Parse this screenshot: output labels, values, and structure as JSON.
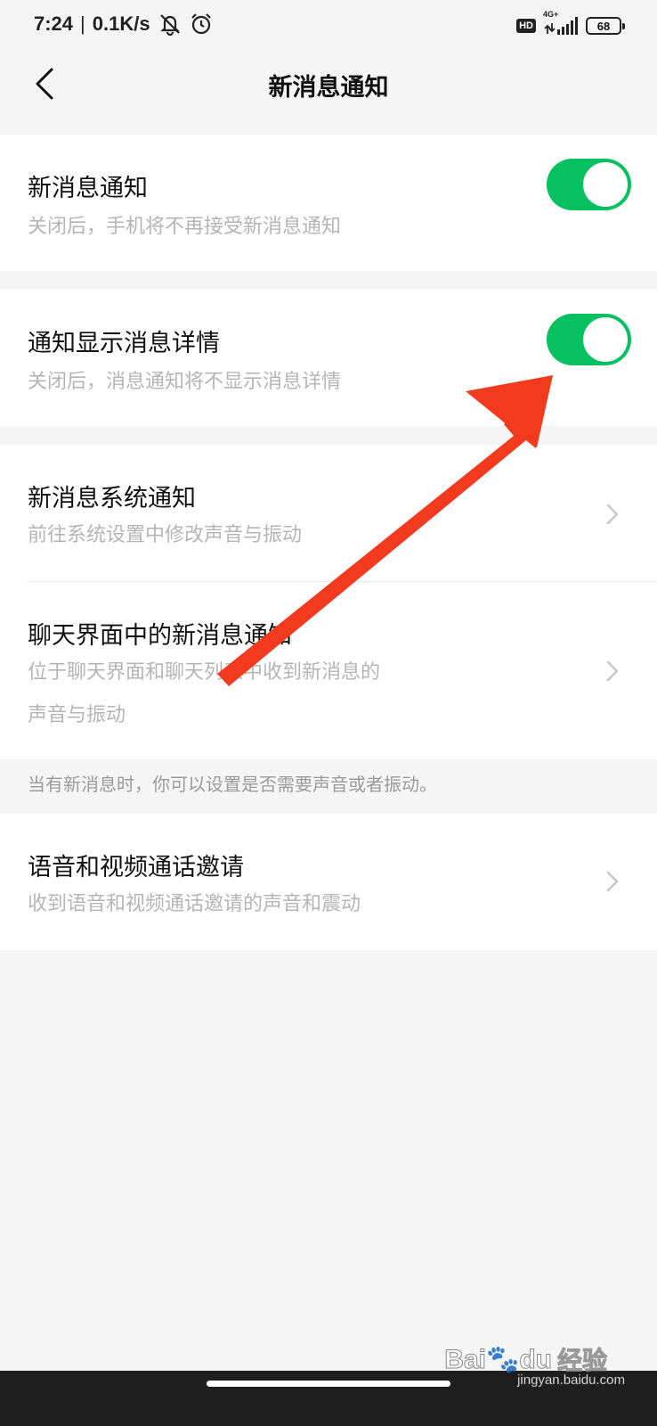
{
  "status_bar": {
    "time": "7:24",
    "net_speed": "0.1K/s",
    "hd": "HD",
    "network_type": "4G+",
    "battery": "68",
    "icons": [
      "mute-icon",
      "alarm-icon",
      "signal-icon",
      "battery-icon"
    ]
  },
  "nav": {
    "title": "新消息通知",
    "back_icon": "back-chevron-icon"
  },
  "settings": {
    "new_message_notify": {
      "title": "新消息通知",
      "subtitle": "关闭后，手机将不再接受新消息通知",
      "enabled": true
    },
    "show_details": {
      "title": "通知显示消息详情",
      "subtitle": "关闭后，消息通知将不显示消息详情",
      "enabled": true
    },
    "system_notify": {
      "title": "新消息系统通知",
      "subtitle": "前往系统设置中修改声音与振动"
    },
    "chat_notify": {
      "title": "聊天界面中的新消息通知",
      "subtitle_line1": "位于聊天界面和聊天列表中收到新消息的",
      "subtitle_line2": "声音与振动"
    },
    "hint": "当有新消息时，你可以设置是否需要声音或者振动。",
    "call_invite": {
      "title": "语音和视频通话邀请",
      "subtitle": "收到语音和视频通话邀请的声音和震动"
    }
  },
  "colors": {
    "toggle_on": "#07c160",
    "arrow": "#f23a1f",
    "background": "#f5f5f5"
  },
  "watermark": {
    "logo": "Bai",
    "logo_suffix": "du",
    "text": "经验",
    "url": "jingyan.baidu.com"
  }
}
